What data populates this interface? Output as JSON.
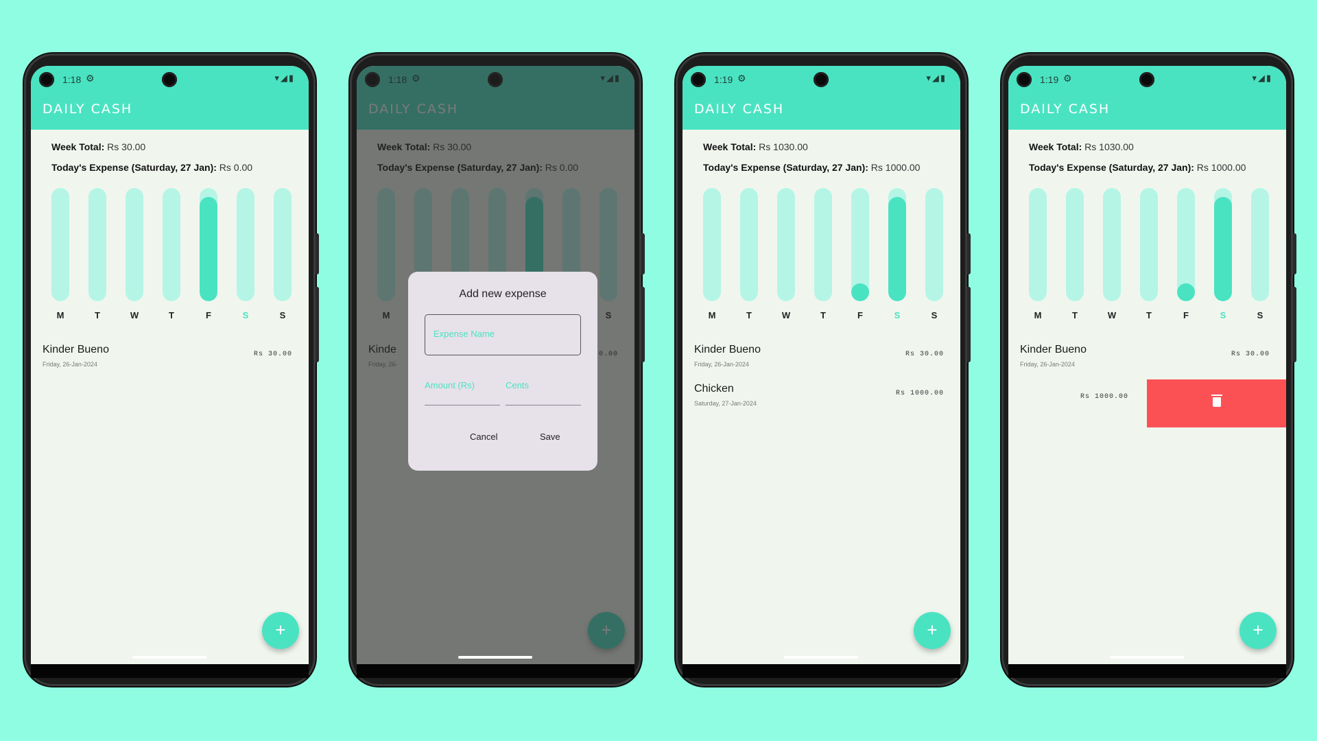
{
  "colors": {
    "background": "#8ffde2",
    "accent": "#4ae3c2",
    "bar_track": "#b5f5e6",
    "delete": "#fb5155"
  },
  "screens": [
    {
      "status_time": "1:18",
      "app_title": "DAILY CASH",
      "week_total_label": "Week Total:",
      "week_total_value": "Rs 30.00",
      "today_label": "Today's Expense (Saturday, 27 Jan):",
      "today_value": "Rs 0.00",
      "days": [
        "M",
        "T",
        "W",
        "T",
        "F",
        "S",
        "S"
      ],
      "bar_fractions": [
        0,
        0,
        0,
        0,
        0.92,
        0,
        0
      ],
      "expenses": [
        {
          "name": "Kinder Bueno",
          "date": "Friday, 26-Jan-2024",
          "amount": "Rs 30.00"
        }
      ]
    },
    {
      "status_time": "1:18",
      "app_title": "DAILY CASH",
      "week_total_label": "Week Total:",
      "week_total_value": "Rs 30.00",
      "today_label": "Today's Expense (Saturday, 27 Jan):",
      "today_value": "Rs 0.00",
      "days": [
        "M",
        "T",
        "W",
        "T",
        "F",
        "S",
        "S"
      ],
      "bar_fractions": [
        0,
        0,
        0,
        0,
        0.92,
        0,
        0
      ],
      "expenses": [
        {
          "name": "Kinde",
          "date": "Friday, 26-",
          "amount": "30.00"
        }
      ],
      "dialog": {
        "title": "Add new expense",
        "name_placeholder": "Expense Name",
        "amount_placeholder": "Amount (Rs)",
        "cents_placeholder": "Cents",
        "cancel": "Cancel",
        "save": "Save"
      }
    },
    {
      "status_time": "1:19",
      "app_title": "DAILY CASH",
      "week_total_label": "Week Total:",
      "week_total_value": "Rs 1030.00",
      "today_label": "Today's Expense (Saturday, 27 Jan):",
      "today_value": "Rs 1000.00",
      "days": [
        "M",
        "T",
        "W",
        "T",
        "F",
        "S",
        "S"
      ],
      "bar_fractions": [
        0,
        0,
        0,
        0,
        0.15,
        0.92,
        0
      ],
      "expenses": [
        {
          "name": "Kinder Bueno",
          "date": "Friday, 26-Jan-2024",
          "amount": "Rs 30.00"
        },
        {
          "name": "Chicken",
          "date": "Saturday, 27-Jan-2024",
          "amount": "Rs 1000.00"
        }
      ]
    },
    {
      "status_time": "1:19",
      "app_title": "DAILY CASH",
      "week_total_label": "Week Total:",
      "week_total_value": "Rs 1030.00",
      "today_label": "Today's Expense (Saturday, 27 Jan):",
      "today_value": "Rs 1000.00",
      "days": [
        "M",
        "T",
        "W",
        "T",
        "F",
        "S",
        "S"
      ],
      "bar_fractions": [
        0,
        0,
        0,
        0,
        0.15,
        0.92,
        0
      ],
      "expenses": [
        {
          "name": "Kinder Bueno",
          "date": "Friday, 26-Jan-2024",
          "amount": "Rs 30.00"
        },
        {
          "name": "",
          "date": "",
          "amount": "Rs 1000.00"
        }
      ],
      "delete_icon": "trash-icon"
    }
  ],
  "fab_label": "+"
}
